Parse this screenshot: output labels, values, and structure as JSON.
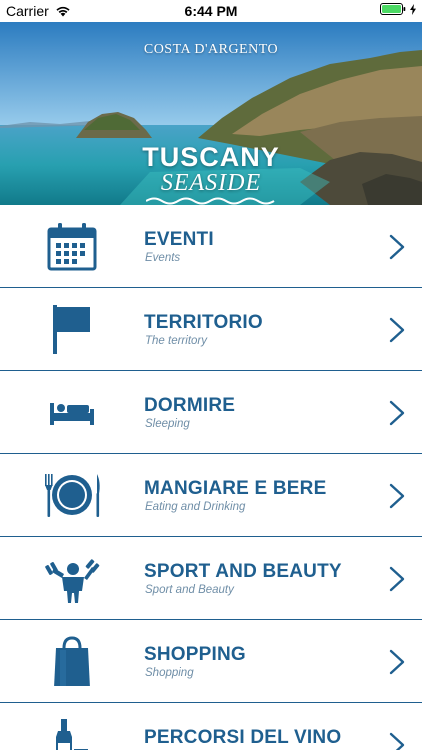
{
  "status_bar": {
    "carrier": "Carrier",
    "time": "6:44 PM",
    "wifi_icon": "wifi-icon",
    "battery_icon": "battery-icon"
  },
  "hero": {
    "subtitle": "COSTA D'ARGENTO",
    "logo_top": "TUSCANY",
    "logo_bottom": "SEASIDE"
  },
  "colors": {
    "brand_blue": "#1f5f8f",
    "subtitle_gray": "#6f8ea7"
  },
  "menu": {
    "items": [
      {
        "title": "EVENTI",
        "subtitle": "Events",
        "icon": "calendar-icon"
      },
      {
        "title": "TERRITORIO",
        "subtitle": "The territory",
        "icon": "flag-icon"
      },
      {
        "title": "DORMIRE",
        "subtitle": "Sleeping",
        "icon": "bed-icon"
      },
      {
        "title": "MANGIARE E BERE",
        "subtitle": "Eating and Drinking",
        "icon": "plate-cutlery-icon"
      },
      {
        "title": "SPORT AND BEAUTY",
        "subtitle": "Sport and Beauty",
        "icon": "weightlifter-icon"
      },
      {
        "title": "SHOPPING",
        "subtitle": "Shopping",
        "icon": "shopping-bag-icon"
      },
      {
        "title": "PERCORSI DEL VINO",
        "subtitle": "",
        "icon": "wine-icon"
      }
    ]
  }
}
